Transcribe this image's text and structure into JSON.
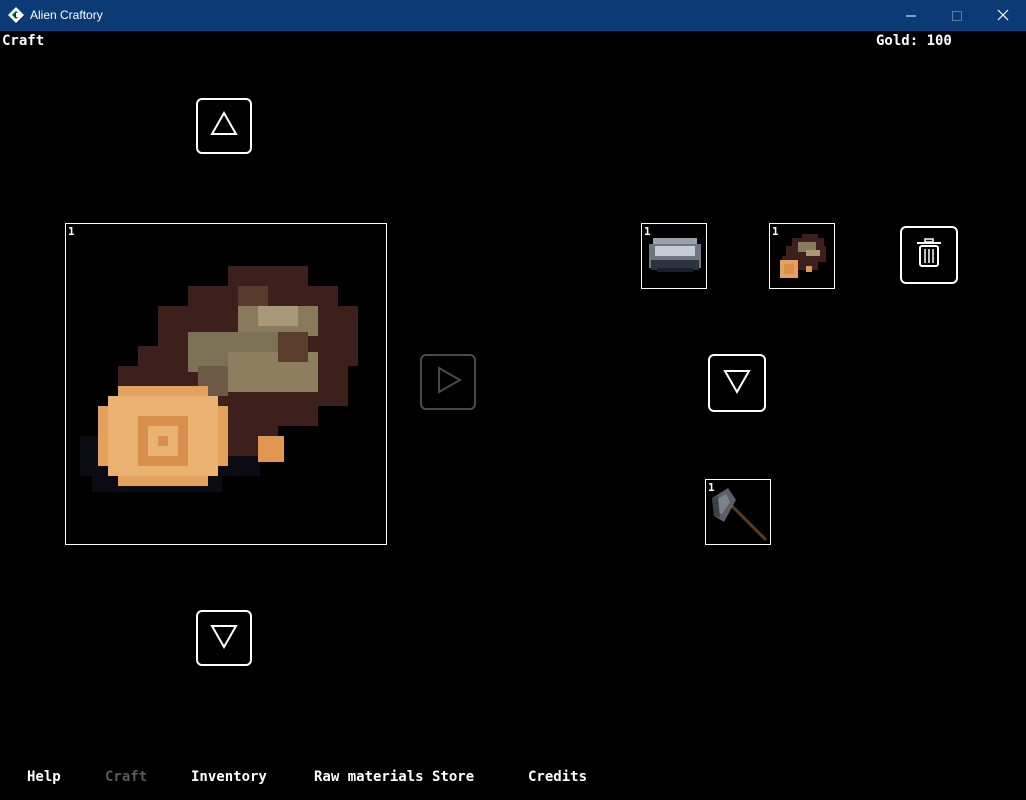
{
  "window": {
    "title": "Alien Craftory",
    "icons": {
      "app": "app-logo-icon",
      "minimize": "minimize-icon",
      "maximize": "maximize-icon",
      "close": "close-icon"
    }
  },
  "header": {
    "page_title": "Craft",
    "gold_label": "Gold: 100"
  },
  "selected_item": {
    "quantity": "1",
    "icon": "wood-log-icon"
  },
  "controls": {
    "up_icon": "triangle-up-icon",
    "down_icon": "triangle-down-icon",
    "craft_icon": "triangle-right-icon",
    "craft_disabled": true,
    "recipe_down_icon": "triangle-down-icon",
    "trash_icon": "trash-icon"
  },
  "ingredients": [
    {
      "quantity": "1",
      "icon": "stone-ingot-icon"
    },
    {
      "quantity": "1",
      "icon": "wood-log-icon"
    }
  ],
  "result": {
    "quantity": "1",
    "icon": "axe-icon"
  },
  "nav": [
    {
      "label": "Help",
      "active": false
    },
    {
      "label": "Craft",
      "active": true
    },
    {
      "label": "Inventory",
      "active": false
    },
    {
      "label": "Raw materials Store",
      "active": false
    },
    {
      "label": "Credits",
      "active": false
    }
  ],
  "colors": {
    "titlebar": "#0b3a75",
    "background": "#000000",
    "text": "#ffffff",
    "inactive_nav": "#5a5a5a",
    "disabled_border": "#4a4a4a",
    "log_bark": "#3d201c",
    "log_face": "#e3a15e",
    "log_moss": "#8a7a5c"
  }
}
